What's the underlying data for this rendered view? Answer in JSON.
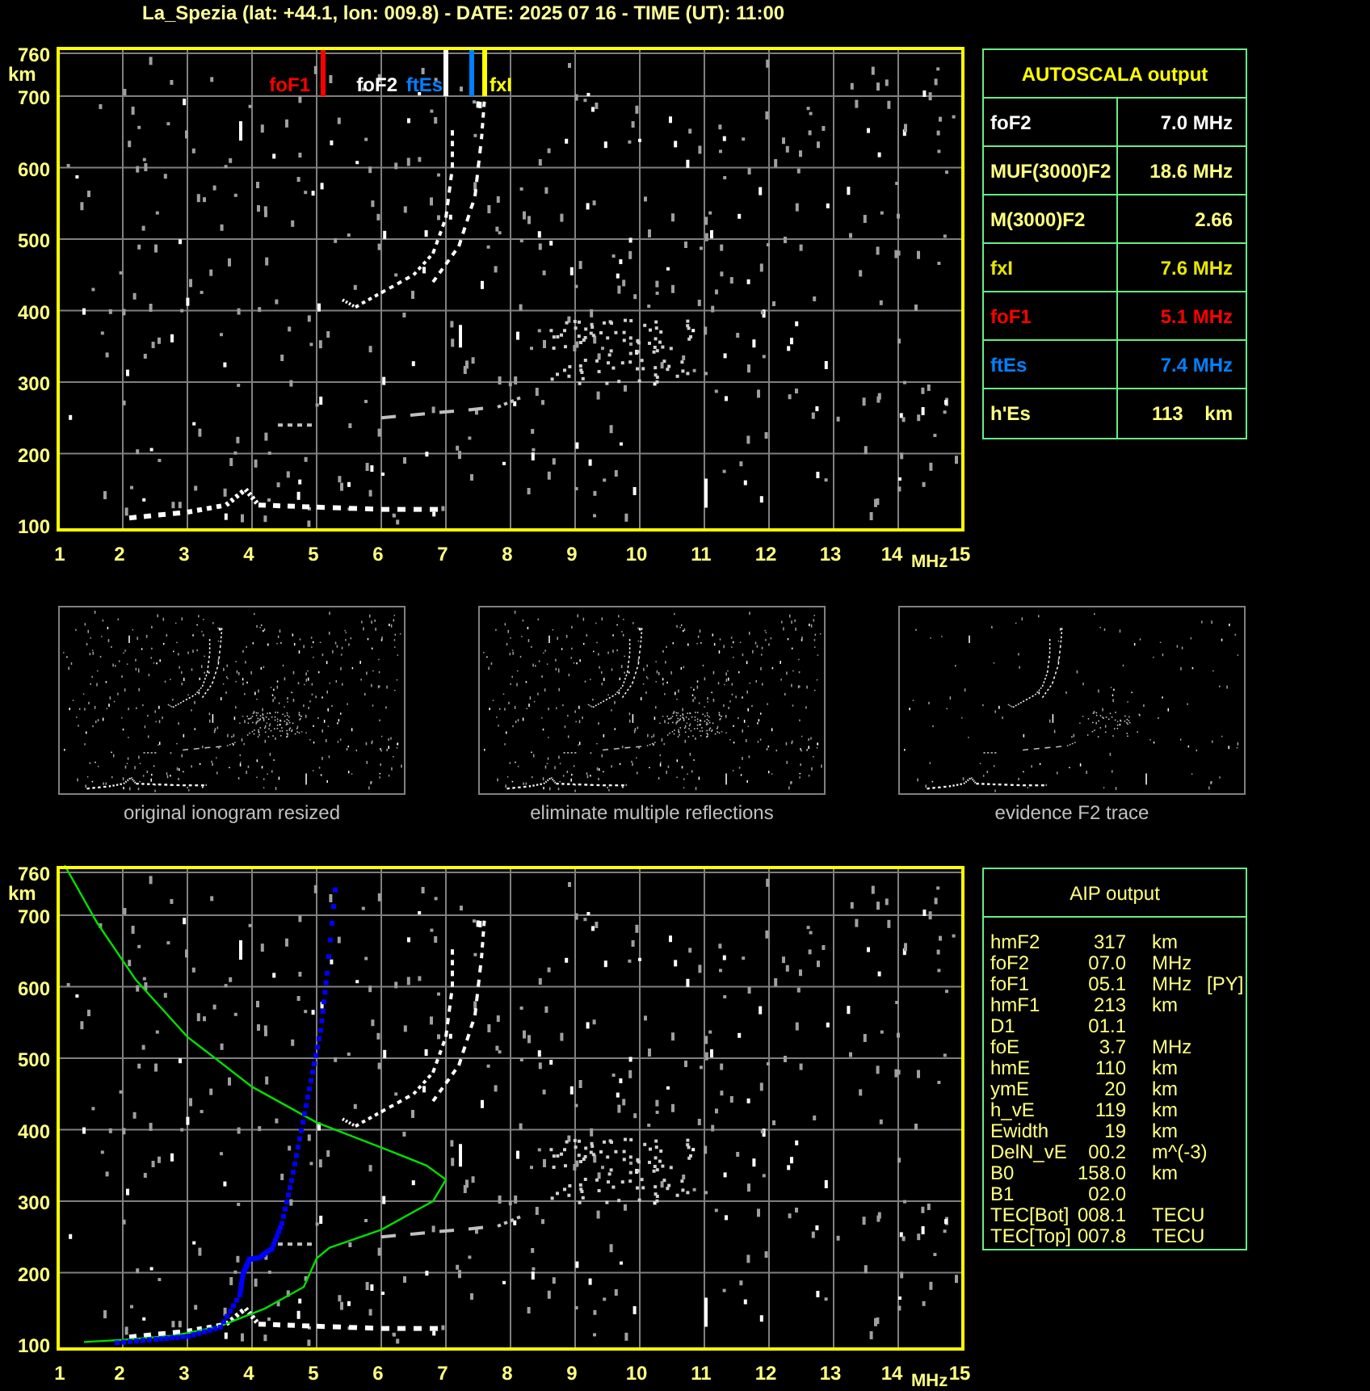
{
  "title": "La_Spezia (lat: +44.1, lon: 009.8) - DATE: 2025 07 16 - TIME (UT): 11:00",
  "ionogram": {
    "y_unit": "km",
    "x_unit": "MHz",
    "y_ticks": [
      "760",
      "700",
      "600",
      "500",
      "400",
      "300",
      "200",
      "100"
    ],
    "x_ticks": [
      "1",
      "2",
      "3",
      "4",
      "5",
      "6",
      "7",
      "8",
      "9",
      "10",
      "11",
      "12",
      "13",
      "14",
      "15"
    ],
    "markers": [
      {
        "label": "foF1",
        "color": "#ff0000"
      },
      {
        "label": "foF2",
        "color": "#ffffff"
      },
      {
        "label": "ftEs",
        "color": "#0080ff"
      },
      {
        "label": "fxI",
        "color": "#ffff00"
      }
    ]
  },
  "autoscala": {
    "title": "AUTOSCALA output",
    "rows": [
      {
        "label": "foF2",
        "value": "7.0 MHz",
        "color": "#ffffff"
      },
      {
        "label": "MUF(3000)F2",
        "value": "18.6 MHz",
        "color": "#ffff80"
      },
      {
        "label": "M(3000)F2",
        "value": "2.66",
        "color": "#ffff80"
      },
      {
        "label": "fxI",
        "value": "7.6 MHz",
        "color": "#e6e600"
      },
      {
        "label": "foF1",
        "value": "5.1 MHz",
        "color": "#ff0000"
      },
      {
        "label": "ftEs",
        "value": "7.4 MHz",
        "color": "#0080ff"
      },
      {
        "label": "h'Es",
        "value": "113    km",
        "color": "#ffff80"
      }
    ]
  },
  "thumbnails": [
    {
      "caption": "original ionogram resized"
    },
    {
      "caption": "eliminate multiple reflections"
    },
    {
      "caption": "evidence F2 trace"
    }
  ],
  "profile_plot": {
    "y_unit": "km",
    "x_unit": "MHz",
    "y_ticks": [
      "760",
      "700",
      "600",
      "500",
      "400",
      "300",
      "200",
      "100"
    ],
    "x_ticks": [
      "1",
      "2",
      "3",
      "4",
      "5",
      "6",
      "7",
      "8",
      "9",
      "10",
      "11",
      "12",
      "13",
      "14",
      "15"
    ]
  },
  "aip": {
    "title": "AIP output",
    "rows": [
      {
        "name": "hmF2",
        "value": "317",
        "unit": "km"
      },
      {
        "name": "foF2",
        "value": "07.0",
        "unit": "MHz"
      },
      {
        "name": "foF1",
        "value": "05.1",
        "unit": "MHz",
        "note": "[PY]"
      },
      {
        "name": "hmF1",
        "value": "213",
        "unit": "km"
      },
      {
        "name": "D1",
        "value": "01.1"
      },
      {
        "name": "foE",
        "value": "3.7",
        "unit": "MHz"
      },
      {
        "name": "hmE",
        "value": "110",
        "unit": "km"
      },
      {
        "name": "ymE",
        "value": "20",
        "unit": "km"
      },
      {
        "name": "h_vE",
        "value": "119",
        "unit": "km"
      },
      {
        "name": "Ewidth",
        "value": "19",
        "unit": "km"
      },
      {
        "name": "DelN_vE",
        "value": "00.2",
        "unit": "m^(-3)"
      },
      {
        "name": "B0",
        "value": "158.0",
        "unit": "km"
      },
      {
        "name": "B1",
        "value": "02.0"
      },
      {
        "name": "TEC[Bot]",
        "value": "008.1",
        "unit": "TECU"
      },
      {
        "name": "TEC[Top]",
        "value": "007.8",
        "unit": "TECU"
      }
    ]
  }
}
